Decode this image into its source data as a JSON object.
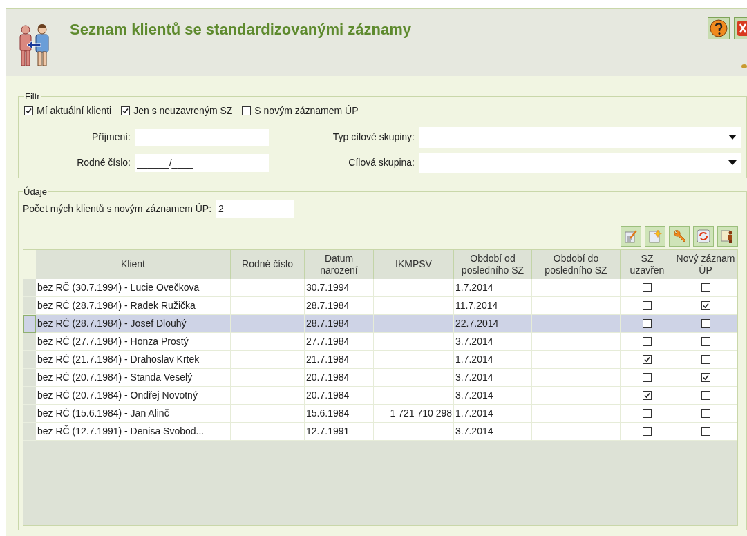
{
  "header": {
    "title": "Seznam klientů se standardizovanými záznamy"
  },
  "filter": {
    "legend": "Filtr",
    "checkboxes": [
      {
        "label": "Mí aktuální klienti",
        "checked": true
      },
      {
        "label": "Jen s neuzavreným SZ",
        "checked": true
      },
      {
        "label": "S novým záznamem ÚP",
        "checked": false
      }
    ],
    "surname": {
      "label": "Příjmení:"
    },
    "birth_number": {
      "label": "Rodné číslo:",
      "value": "______/____"
    },
    "target_group_type": {
      "label": "Typ cílové skupiny:"
    },
    "target_group": {
      "label": "Cílová skupina:"
    }
  },
  "data": {
    "legend": "Údaje",
    "count": {
      "label": "Počet mých klientů s novým záznamem ÚP:",
      "value": "2"
    },
    "table": {
      "columns": [
        "Klient",
        "Rodné číslo",
        "Datum narození",
        "IKMPSV",
        "Období od posledního SZ",
        "Období do posledního SZ",
        "SZ uzavřen",
        "Nový záznam ÚP"
      ],
      "rows": [
        {
          "client": "bez RČ (30.7.1994) - Lucie Ovečkova",
          "birth_number": "",
          "birth_date": "30.7.1994",
          "ikmpsv": "",
          "from": "1.7.2014",
          "to": "",
          "closed": false,
          "new_record": false,
          "selected": false
        },
        {
          "client": "bez RČ (28.7.1984) - Radek Ružička",
          "birth_number": "",
          "birth_date": "28.7.1984",
          "ikmpsv": "",
          "from": "11.7.2014",
          "to": "",
          "closed": false,
          "new_record": true,
          "selected": false
        },
        {
          "client": "bez RČ (28.7.1984) - Josef Dlouhý",
          "birth_number": "",
          "birth_date": "28.7.1984",
          "ikmpsv": "",
          "from": "22.7.2014",
          "to": "",
          "closed": false,
          "new_record": false,
          "selected": true
        },
        {
          "client": "bez RČ (27.7.1984) - Honza Prostý",
          "birth_number": "",
          "birth_date": "27.7.1984",
          "ikmpsv": "",
          "from": "3.7.2014",
          "to": "",
          "closed": false,
          "new_record": false,
          "selected": false
        },
        {
          "client": "bez RČ (21.7.1984) - Drahoslav Krtek",
          "birth_number": "",
          "birth_date": "21.7.1984",
          "ikmpsv": "",
          "from": "1.7.2014",
          "to": "",
          "closed": true,
          "new_record": false,
          "selected": false
        },
        {
          "client": "bez RČ (20.7.1984) - Standa Veselý",
          "birth_number": "",
          "birth_date": "20.7.1984",
          "ikmpsv": "",
          "from": "3.7.2014",
          "to": "",
          "closed": false,
          "new_record": true,
          "selected": false
        },
        {
          "client": "bez RČ (20.7.1984) - Ondřej Novotný",
          "birth_number": "",
          "birth_date": "20.7.1984",
          "ikmpsv": "",
          "from": "3.7.2014",
          "to": "",
          "closed": true,
          "new_record": false,
          "selected": false
        },
        {
          "client": "bez RČ (15.6.1984) - Jan Alinč",
          "birth_number": "",
          "birth_date": "15.6.1984",
          "ikmpsv": "1 721 710 298",
          "from": "1.7.2014",
          "to": "",
          "closed": false,
          "new_record": false,
          "selected": false
        },
        {
          "client": "bez RČ (12.7.1991) - Denisa Svobod...",
          "birth_number": "",
          "birth_date": "12.7.1991",
          "ikmpsv": "",
          "from": "3.7.2014",
          "to": "",
          "closed": false,
          "new_record": false,
          "selected": false
        }
      ]
    }
  }
}
